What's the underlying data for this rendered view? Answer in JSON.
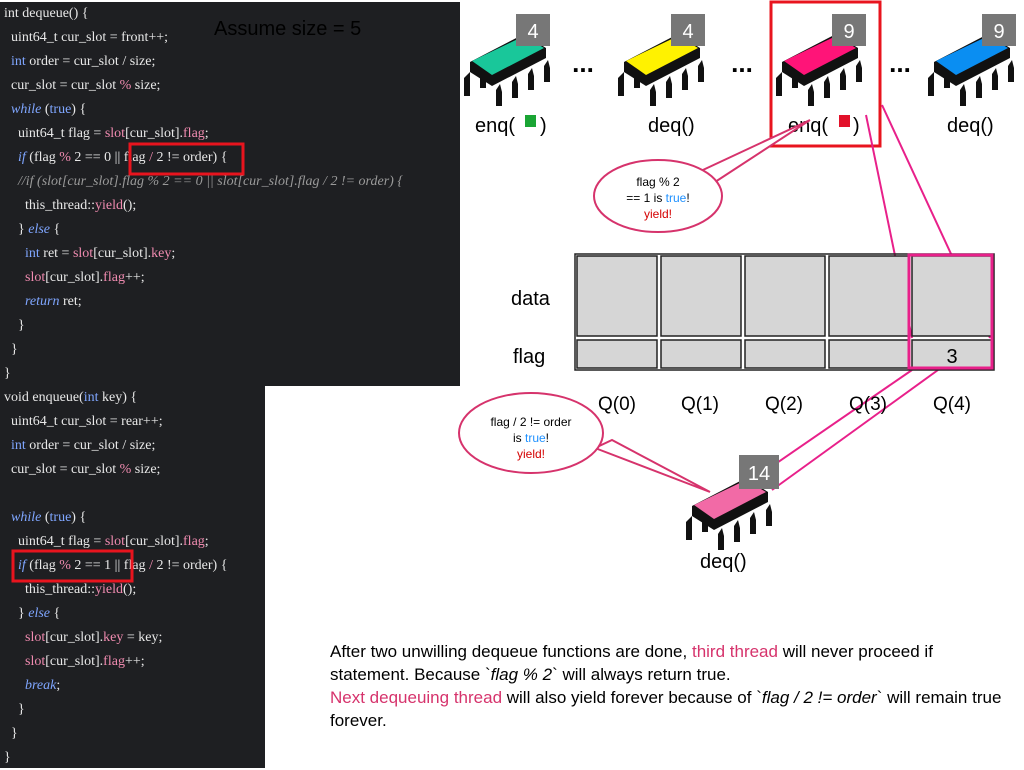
{
  "assume_label": "Assume size = 5",
  "code": {
    "dequeue": [
      [
        [
          "t",
          "int dequeue() {"
        ]
      ],
      [
        [
          "t",
          "  uint64_t cur_slot = front++;"
        ]
      ],
      [
        [
          "t",
          "  "
        ],
        [
          "kw",
          "int"
        ],
        [
          "t",
          " order = cur_slot / size;"
        ]
      ],
      [
        [
          "t",
          "  cur_slot = cur_slot "
        ],
        [
          "fn",
          "%"
        ],
        [
          "t",
          " size;"
        ]
      ],
      [
        [
          "t",
          "  "
        ],
        [
          "it",
          "while"
        ],
        [
          "t",
          " ("
        ],
        [
          "kw",
          "true"
        ],
        [
          "t",
          ") {"
        ]
      ],
      [
        [
          "t",
          "    uint64_t flag = "
        ],
        [
          "fn",
          "slot"
        ],
        [
          "t",
          "[cur_slot]."
        ],
        [
          "fn",
          "flag"
        ],
        [
          "t",
          ";"
        ]
      ],
      [
        [
          "t",
          "    "
        ],
        [
          "it",
          "if"
        ],
        [
          "t",
          " (flag "
        ],
        [
          "fn",
          "%"
        ],
        [
          "t",
          " 2 == 0 || flag "
        ],
        [
          "fn",
          "/"
        ],
        [
          "t",
          " 2 != order) {"
        ]
      ],
      [
        [
          "cm",
          "    //if (slot[cur_slot].flag % 2 == 0 || slot[cur_slot].flag / 2 != order) {"
        ]
      ],
      [
        [
          "t",
          "      this_thread::"
        ],
        [
          "fn",
          "yield"
        ],
        [
          "t",
          "();"
        ]
      ],
      [
        [
          "t",
          "    } "
        ],
        [
          "it",
          "else"
        ],
        [
          "t",
          " {"
        ]
      ],
      [
        [
          "t",
          "      "
        ],
        [
          "kw",
          "int"
        ],
        [
          "t",
          " ret = "
        ],
        [
          "fn",
          "slot"
        ],
        [
          "t",
          "[cur_slot]."
        ],
        [
          "fn",
          "key"
        ],
        [
          "t",
          ";"
        ]
      ],
      [
        [
          "t",
          "      "
        ],
        [
          "fn",
          "slot"
        ],
        [
          "t",
          "[cur_slot]."
        ],
        [
          "fn",
          "flag"
        ],
        [
          "t",
          "++;"
        ]
      ],
      [
        [
          "t",
          "      "
        ],
        [
          "it",
          "return"
        ],
        [
          "t",
          " ret;"
        ]
      ],
      [
        [
          "t",
          "    }"
        ]
      ],
      [
        [
          "t",
          "  }"
        ]
      ],
      [
        [
          "t",
          "}"
        ]
      ]
    ],
    "enqueue": [
      [
        [
          "t",
          "void enqueue("
        ],
        [
          "kw",
          "int"
        ],
        [
          "t",
          " key) {"
        ]
      ],
      [
        [
          "t",
          "  uint64_t cur_slot = rear++;"
        ]
      ],
      [
        [
          "t",
          "  "
        ],
        [
          "kw",
          "int"
        ],
        [
          "t",
          " order = cur_slot / size;"
        ]
      ],
      [
        [
          "t",
          "  cur_slot = cur_slot "
        ],
        [
          "fn",
          "%"
        ],
        [
          "t",
          " size;"
        ]
      ],
      [
        [
          "t",
          ""
        ]
      ],
      [
        [
          "t",
          "  "
        ],
        [
          "it",
          "while"
        ],
        [
          "t",
          " ("
        ],
        [
          "kw",
          "true"
        ],
        [
          "t",
          ") {"
        ]
      ],
      [
        [
          "t",
          "    uint64_t flag = "
        ],
        [
          "fn",
          "slot"
        ],
        [
          "t",
          "[cur_slot]."
        ],
        [
          "fn",
          "flag"
        ],
        [
          "t",
          ";"
        ]
      ],
      [
        [
          "t",
          "    "
        ],
        [
          "it",
          "if"
        ],
        [
          "t",
          " (flag "
        ],
        [
          "fn",
          "%"
        ],
        [
          "t",
          " 2 == 1 || flag "
        ],
        [
          "fn",
          "/"
        ],
        [
          "t",
          " 2 != order) {"
        ]
      ],
      [
        [
          "t",
          "      this_thread::"
        ],
        [
          "fn",
          "yield"
        ],
        [
          "t",
          "();"
        ]
      ],
      [
        [
          "t",
          "    } "
        ],
        [
          "it",
          "else"
        ],
        [
          "t",
          " {"
        ]
      ],
      [
        [
          "t",
          "      "
        ],
        [
          "fn",
          "slot"
        ],
        [
          "t",
          "[cur_slot]."
        ],
        [
          "fn",
          "key"
        ],
        [
          "t",
          " = key;"
        ]
      ],
      [
        [
          "t",
          "      "
        ],
        [
          "fn",
          "slot"
        ],
        [
          "t",
          "[cur_slot]."
        ],
        [
          "fn",
          "flag"
        ],
        [
          "t",
          "++;"
        ]
      ],
      [
        [
          "t",
          "      "
        ],
        [
          "it",
          "break"
        ],
        [
          "t",
          ";"
        ]
      ],
      [
        [
          "t",
          "    }"
        ]
      ],
      [
        [
          "t",
          "  }"
        ]
      ],
      [
        [
          "t",
          "}"
        ]
      ]
    ]
  },
  "threads": [
    {
      "badge": "4",
      "op": "enq(",
      "op_close": ")",
      "marker_color": "#1aa534",
      "color": "#19c79a"
    },
    {
      "badge": "4",
      "op": "deq()",
      "color": "#fff200"
    },
    {
      "badge": "9",
      "op": "enq(",
      "op_close": ")",
      "marker_color": "#e2112a",
      "color": "#ff1478"
    },
    {
      "badge": "9",
      "op": "deq()",
      "color": "#0a8ef2"
    }
  ],
  "ellipsis": "...",
  "bubble_top": {
    "line1": "flag % 2",
    "line2a": "== 1 is ",
    "line2b": "true",
    "line2c": "!",
    "line3": "yield!"
  },
  "bubble_bottom": {
    "line1": "flag / 2 != order",
    "line2a": "is ",
    "line2b": "true",
    "line2c": "!",
    "line3": "yield!"
  },
  "queue": {
    "row_data": "data",
    "row_flag": "flag",
    "slots": [
      "Q(0)",
      "Q(1)",
      "Q(2)",
      "Q(3)",
      "Q(4)"
    ],
    "flag_values": [
      "",
      "",
      "",
      "",
      "3"
    ]
  },
  "waiting_thread": {
    "badge": "14",
    "op": "deq()",
    "color": "#f26aa6"
  },
  "note": {
    "p1": "After two unwilling dequeue functions are done, ",
    "p1_pink": "third thread",
    "p2": " will never proceed if statement. Because `",
    "p2_em": "flag % 2",
    "p3": "` will always return true.",
    "p4_pink": "Next dequeuing thread",
    "p5": " will also yield forever because of `",
    "p5_em": "flag / 2 != order",
    "p6": "` will remain true forever."
  },
  "colors": {
    "highlight": "#e8141e",
    "pink_line": "#e8208a",
    "true_text": "#1e90ff",
    "yield_text": "#d40000"
  }
}
